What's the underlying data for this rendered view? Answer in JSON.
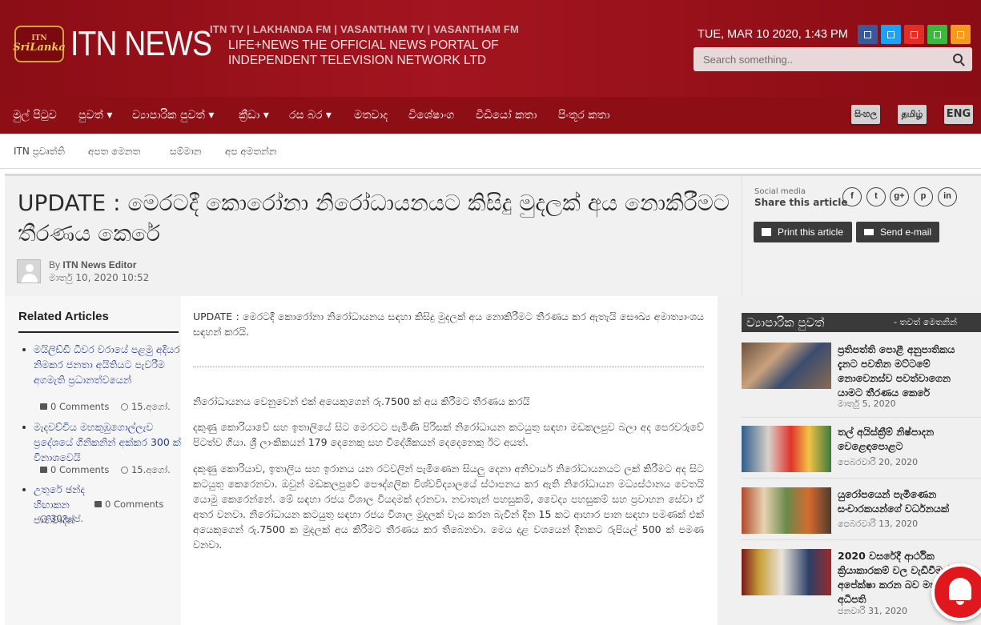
{
  "header": {
    "logo_badge_top": "ITN",
    "logo_badge_bottom": "SriLanka",
    "logo_text": "ITN NEWS",
    "channels": "ITN TV | LAKHANDA FM | VASANTHAM TV | VASANTHAM FM",
    "tagline": "LIFE+NEWS THE OFFICIAL NEWS PORTAL OF INDEPENDENT TELEVISION NETWORK LTD",
    "date": "TUE, MAR 10 2020, 1:43 PM",
    "search_placeholder": "Search something..",
    "social_icons": [
      {
        "name": "facebook-icon",
        "color": "#3b5998"
      },
      {
        "name": "twitter-icon",
        "color": "#1da1f2"
      },
      {
        "name": "youtube-icon",
        "color": "#e52d27"
      },
      {
        "name": "googleplus-icon",
        "color": "#3cb93c"
      },
      {
        "name": "rss-icon",
        "color": "#f29b1d"
      }
    ]
  },
  "nav": {
    "items": [
      "මුල් පිටුව",
      "පුවත් ▾",
      "ව්‍යාපාරික පුවත් ▾",
      "ක්‍රීඩා ▾",
      "රස බර ▾",
      "මතවාද",
      "විශේෂාංග",
      "වීඩියෝ කතා",
      "පිංතූර කතා"
    ],
    "languages": [
      "සිංහල",
      "தமிழ்",
      "ENG"
    ]
  },
  "subnav": {
    "items": [
      "ITN ප්‍රවෘත්ති",
      "අපත මෙනත",
      "සම්මාන",
      "අප අමතන්න"
    ]
  },
  "article": {
    "title": "UPDATE : මෙරටදී කොරෝනා නිරෝධායනයට කිසිදු මුදලක් අය නොකිරීමට තීරණය කෙරේ",
    "by_label": "By",
    "author": "ITN News Editor",
    "date": "මාර්තු 10, 2020 10:52",
    "paragraphs": [
      "UPDATE : මෙරටදී කොරෝනා නිරෝධායනය සඳහා කිසිදු මුදලක් අය නොකිරීමට තීරණය කර ඇතැයි සෞඛ්‍ය අමාත්‍යාංශය සඳහන් කරයි.",
      "නිරෝධායනය වෙනුවෙන් එක් අයෙකුගෙන් රු.7500 ක් අය කිරීමට තීරණය කරයි",
      "දකුණු කොරියාවේ සහ ඉතාලියේ සිට මෙරටට පැමිණි පිරිසක් නිරෝධායන කටයුතු සඳහා මඩකලපුව බලා අද පෙරවරුවේ පිටත්ව ගියා. ශ්‍රී ලාංකිකයන් 179 දෙනෙකු සහ විදේශිකයන් දෙදෙනෙකු ඊට අයත්.",
      "දකුණු කොරියාව, ඉතාලිය සහ ඉරානය යන රටවලින් පැමිණෙන සියලු දෙනා අනිවාර්ය නිරෝධායනයට ලක් කිරීමට අද සිට කටයුතු කෙරෙනවා. ඔවුන් මඩකලපුවේ පෞද්ගලික විශ්වවිද්‍යාලයේ ස්ථාපනය කර ඇති නිරෝධායන මධ්‍යස්ථානය වෙතයි යොමු කෙරෙන්නේ. මේ සඳහා රජය විශාල වියදමක් දරනවා. නවාතැන් පහසුකම්, වෛද්‍ය පහසුකම් සහ ප්‍රවාහන සේවා ඒ අතර වනවා. නිරෝධායන කටයුතු සඳහා රජය විශාල මුදලක් වැය කරන බැවින් දින 15 කට ආහාර පාන සඳහා පමණක් එක් අයෙකුගෙන් රු.7500 ක මුදලක් අය කිරීමට තීරණය කර තිබෙනවා. මෙය දළ වශයෙන් දිනකට රුපියල් 500 ක් පමණ වනවා."
    ]
  },
  "share": {
    "label": "Social media",
    "title": "Share this article",
    "icons": [
      "f",
      "t",
      "g+",
      "p",
      "in"
    ],
    "print_label": "Print this article",
    "email_label": "Send e-mail"
  },
  "related": {
    "title": "Related Articles",
    "items": [
      {
        "title": "මයිලිඩ්ඩි ධීවර වරායේ පළමු අදියර නිමකර ජනතා අයිතියට පැවරීම අගමැති ප්‍රධානත්වයෙන්",
        "comments": "0 Comments",
        "date": "15.අගෝ."
      },
      {
        "title": "මැදවච්චිය මහකුඹුගොල්ලැව ප්‍රදේශයේ ගිනිකනින් අක්කර 300 ක් විනාශවෙයි",
        "comments": "0 Comments",
        "date": "15.අගෝ."
      },
      {
        "title": "උතුරේ ඡන්ද හිඟාකන ජාතිවාදීන්",
        "comments": "0 Comments",
        "date": "30.සැප්."
      }
    ]
  },
  "business": {
    "title": "ව්‍යාපාරික පුවත්",
    "more": "- තවත් මෙතනින්",
    "items": [
      {
        "title": "ප්‍රතිපත්ති පොළී අනුපාතිකය දැනට පවතින මට්ටමේ නොවෙනස්ව පවත්වාගෙන යාමට තීරණය කෙරේ",
        "date": "මාර්තු 5, 2020"
      },
      {
        "title": "තල් අයිස්ක්‍රීම් නිෂ්පාදන වෙළෙඳපොළට",
        "date": "පෙබරවාරි 20, 2020"
      },
      {
        "title": "යුරෝපයෙන් පැමිණෙන සංචාරකයන්ගේ වර්ධනයක්",
        "date": "පෙබරවාරි 13, 2020"
      },
      {
        "title": "2020 වසරේදී ආර්ථික ක්‍රියාකාරකම් වල වැඩිවීමක් අපේක්ෂා කරන බව මහබැංකු අධිපති",
        "date": "ජනවාරි 31, 2020"
      }
    ]
  }
}
